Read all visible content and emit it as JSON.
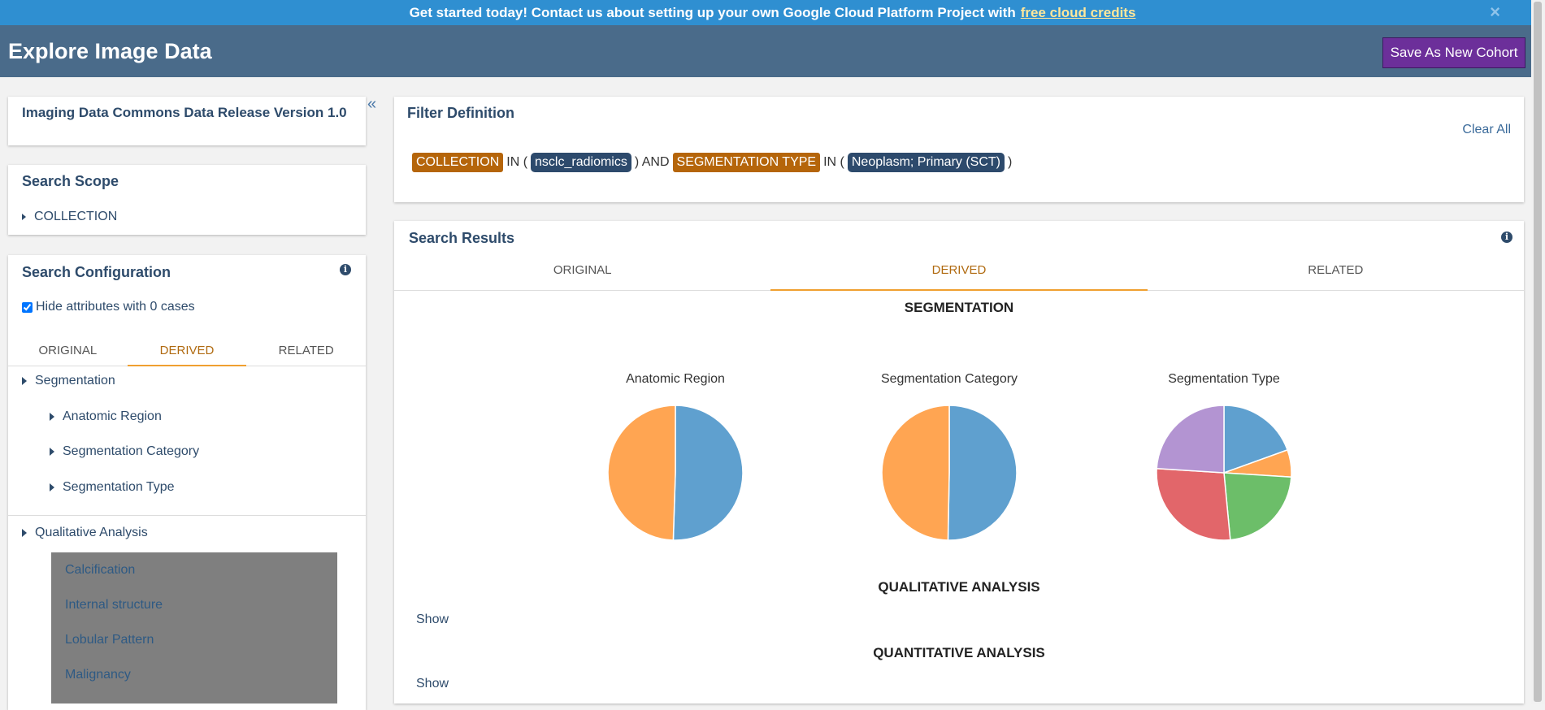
{
  "banner": {
    "text": "Get started today! Contact us about setting up your own Google Cloud Platform Project with",
    "link": "free cloud credits",
    "close": "×"
  },
  "header": {
    "title": "Explore Image Data",
    "save_label": "Save As New Cohort"
  },
  "sidebar": {
    "collapse": "«",
    "release_title": "Imaging Data Commons Data Release Version 1.0",
    "scope": {
      "title": "Search Scope",
      "items": [
        "COLLECTION"
      ]
    },
    "config": {
      "title": "Search Configuration",
      "hide_zero_label": "Hide attributes with 0 cases",
      "tabs": [
        "ORIGINAL",
        "DERIVED",
        "RELATED"
      ],
      "active_tab": "DERIVED",
      "segmentation": {
        "label": "Segmentation",
        "children": [
          "Anatomic Region",
          "Segmentation Category",
          "Segmentation Type"
        ]
      },
      "qualitative": {
        "label": "Qualitative Analysis",
        "children": [
          "Calcification",
          "Internal structure",
          "Lobular Pattern",
          "Malignancy"
        ]
      }
    }
  },
  "filter": {
    "title": "Filter Definition",
    "clear_all": "Clear All",
    "attr1": "COLLECTION",
    "op1": "IN (",
    "val1": "nsclc_radiomics",
    "and": ") AND",
    "attr2": "SEGMENTATION TYPE",
    "op2": "IN (",
    "val2": "Neoplasm; Primary (SCT)",
    "close": ")"
  },
  "results": {
    "title": "Search Results",
    "tabs": [
      "ORIGINAL",
      "DERIVED",
      "RELATED"
    ],
    "active_tab": "DERIVED",
    "segmentation_title": "SEGMENTATION",
    "qualitative_title": "QUALITATIVE ANALYSIS",
    "quantitative_title": "QUANTITATIVE ANALYSIS",
    "show1": "Show",
    "show2": "Show"
  },
  "chart_data": [
    {
      "type": "pie",
      "title": "Anatomic Region",
      "values": [
        50.5,
        49.5
      ],
      "colors": [
        "#5fa0cf",
        "#ffa552"
      ]
    },
    {
      "type": "pie",
      "title": "Segmentation Category",
      "values": [
        50.3,
        49.7
      ],
      "colors": [
        "#5fa0cf",
        "#ffa552"
      ]
    },
    {
      "type": "pie",
      "title": "Segmentation Type",
      "values": [
        19.5,
        6.5,
        22.5,
        27.5,
        24
      ],
      "colors": [
        "#5fa0cf",
        "#ffa552",
        "#6cbe69",
        "#e2666a",
        "#b394d2"
      ]
    }
  ]
}
